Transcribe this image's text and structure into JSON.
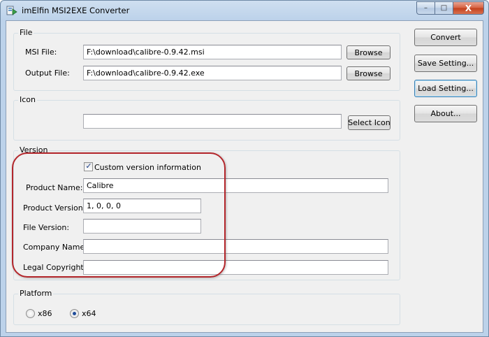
{
  "window": {
    "title": "imElfin MSI2EXE Converter",
    "controls": {
      "minimize": "–",
      "maximize": "□",
      "close": "X"
    }
  },
  "file_group": {
    "label": "File",
    "msi_label": "MSI File:",
    "msi_value": "F:\\download\\calibre-0.9.42.msi",
    "output_label": "Output File:",
    "output_value": "F:\\download\\calibre-0.9.42.exe",
    "browse_label": "Browse"
  },
  "icon_group": {
    "label": "Icon",
    "icon_path": "",
    "select_icon_label": "Select Icon"
  },
  "version_group": {
    "label": "Version",
    "custom_checkbox_label": "Custom version information",
    "custom_checked": true,
    "product_name_label": "Product Name:",
    "product_name_value": "Calibre",
    "product_version_label": "Product Version:",
    "product_version_value": "1, 0, 0, 0",
    "file_version_label": "File Version:",
    "file_version_value": "",
    "company_name_label": "Company Name:",
    "company_name_value": "",
    "legal_copyright_label": "Legal Copyright:",
    "legal_copyright_value": ""
  },
  "platform_group": {
    "label": "Platform",
    "options": [
      {
        "label": "x86",
        "selected": false
      },
      {
        "label": "x64",
        "selected": true
      }
    ]
  },
  "actions": {
    "convert": "Convert",
    "save_setting": "Save Setting...",
    "load_setting": "Load Setting...",
    "about": "About..."
  },
  "colors": {
    "highlight": "#b3262b",
    "client_bg": "#f0f0f0"
  }
}
